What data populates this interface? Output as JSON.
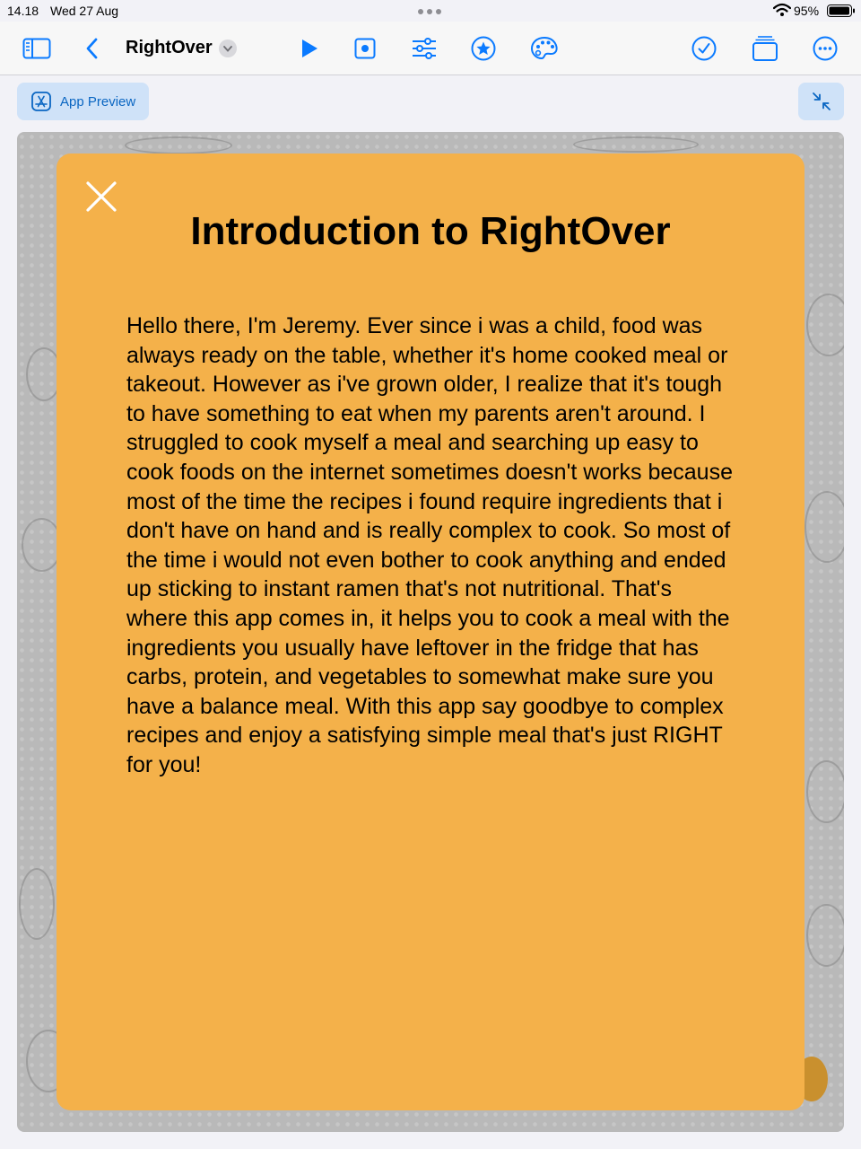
{
  "status_bar": {
    "time": "14.18",
    "date": "Wed 27 Aug",
    "battery": "95%"
  },
  "toolbar": {
    "title": "RightOver",
    "icons": [
      "sidebar-icon",
      "back-chevron-icon",
      "title-menu-chevron-icon",
      "play-icon",
      "stop-icon",
      "sliders-icon",
      "star-icon",
      "palette-icon",
      "checkmark-icon",
      "windows-icon",
      "more-icon"
    ]
  },
  "preview": {
    "button_label": "App Preview"
  },
  "intro": {
    "title": "Introduction to RightOver",
    "body": "Hello there, I'm Jeremy. Ever since i was a child, food was always ready on the table, whether it's home cooked meal or takeout. However as i've grown older, I realize that it's tough to have something to eat when my parents aren't around. I struggled to cook myself a meal and searching up easy to cook foods on the internet sometimes doesn't works because most of the time the recipes i found require ingredients that i don't have on hand and is really complex to cook. So most of the time i would not even bother to cook anything and ended up sticking to instant ramen that's not nutritional. That's where this app comes in, it helps you to cook a meal with the ingredients you usually have leftover in the fridge that has carbs, protein, and vegetables to somewhat make sure you have a balance meal. With this app say goodbye to complex recipes and enjoy a satisfying simple meal that's just RIGHT for you!"
  },
  "colors": {
    "accent": "#0a7aff",
    "card": "#f4b14a",
    "preview_bg": "#b9b9b9"
  }
}
